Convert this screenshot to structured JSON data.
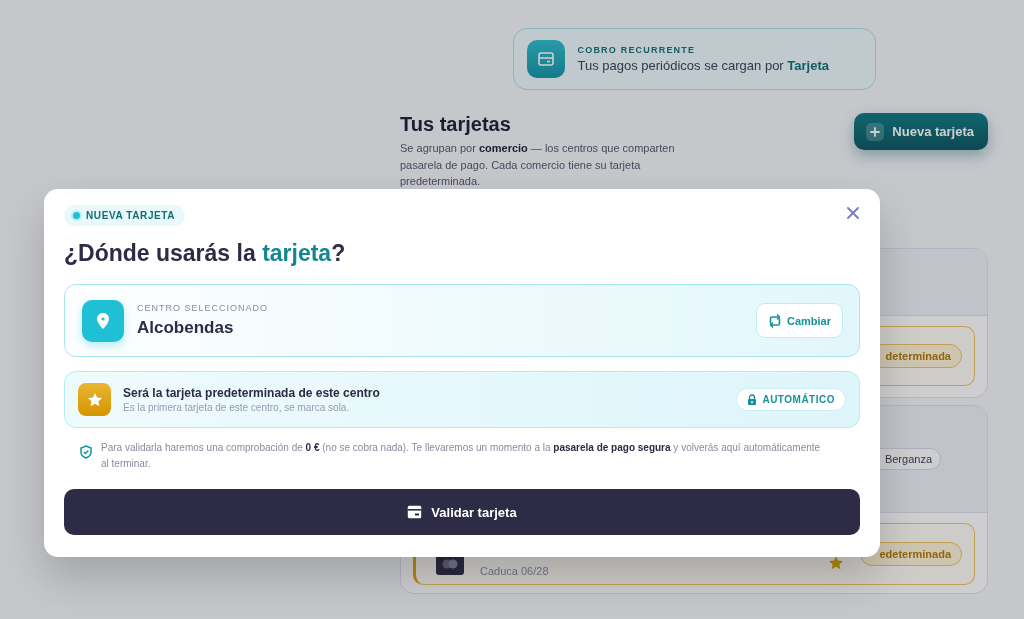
{
  "page": {
    "banner": {
      "label": "COBRO RECURRENTE",
      "text": "Tus pagos periódicos se cargan por **Tarjeta**"
    },
    "heading": "Tus tarjetas",
    "description": "Se agrupan por **comercio** — los centros que comparten pasarela de pago. Cada comercio tiene su tarjeta predeterminada.",
    "new_card_button": "Nueva tarjeta",
    "merchant_groups": [
      {
        "cards": [
          {
            "default_badge": "determinada"
          }
        ]
      },
      {
        "chips": [
          "Berganza"
        ],
        "cards": [
          {
            "expiry": "Caduca 06/28",
            "default_badge": "edeterminada",
            "starred": true
          }
        ]
      }
    ]
  },
  "modal": {
    "badge": "NUEVA TARJETA",
    "title": "¿Dónde usarás la **tarjeta**?",
    "center": {
      "label": "CENTRO SELECCIONADO",
      "name": "Alcobendas",
      "button": "Cambiar"
    },
    "default_notice": {
      "title": "Será la tarjeta predeterminada de este centro",
      "subtitle": "Es la primera tarjeta de este centro, se marca sola.",
      "pill": "AUTOMÁTICO"
    },
    "note": "Para validarla haremos una comprobación de **0 €** (no se cobra nada). Te llevaremos un momento a la **pasarela de pago segura** y volverás aquí automáticamente al terminar.",
    "submit": "Validar tarjeta"
  }
}
